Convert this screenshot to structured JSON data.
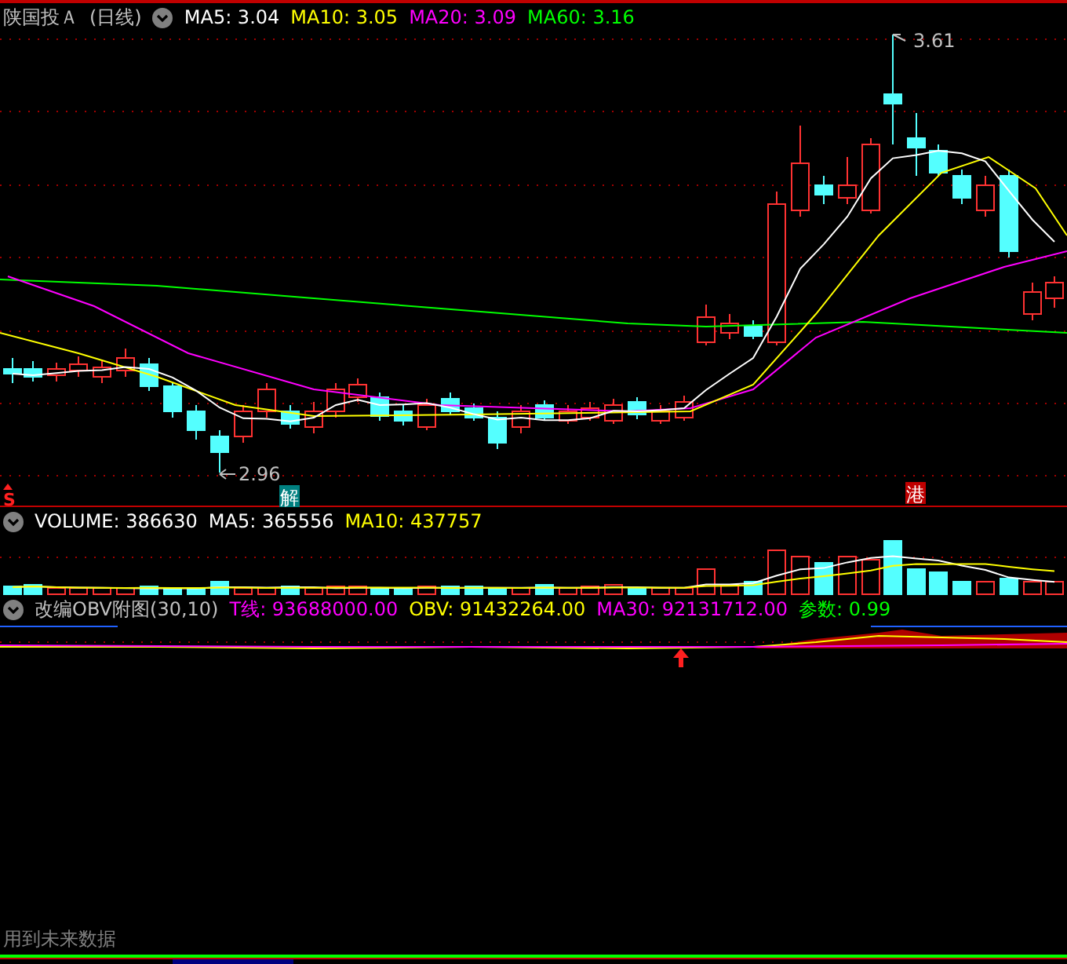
{
  "header": {
    "title": "陕国投Ａ",
    "period": "(日线)",
    "indicators": [
      {
        "label": "MA5: 3.04",
        "color": "#ffffff"
      },
      {
        "label": "MA10: 3.05",
        "color": "#ffff00"
      },
      {
        "label": "MA20: 3.09",
        "color": "#ff00ff"
      },
      {
        "label": "MA60: 3.16",
        "color": "#00ff00"
      }
    ]
  },
  "main_chart": {
    "high_label": "3.61",
    "low_label": "2.96",
    "markers": [
      {
        "kind": "signal",
        "text": "S"
      },
      {
        "kind": "badge",
        "text": "解",
        "color": "#008080"
      },
      {
        "kind": "badge",
        "text": "港",
        "color": "#c00000"
      }
    ]
  },
  "volume_panel": {
    "indicators": [
      {
        "label": "VOLUME: 386630",
        "color": "#ffffff"
      },
      {
        "label": "MA5: 365556",
        "color": "#ffffff"
      },
      {
        "label": "MA10: 437757",
        "color": "#ffff00"
      }
    ]
  },
  "obv_panel": {
    "indicators": [
      {
        "label": "改编OBV附图(30,10)",
        "color": "#c0c0c0"
      },
      {
        "label": "T线: 93688000.00",
        "color": "#ff00ff"
      },
      {
        "label": "OBV: 91432264.00",
        "color": "#ffff00"
      },
      {
        "label": "MA30: 92131712.00",
        "color": "#ff00ff"
      },
      {
        "label": "参数: 0.99",
        "color": "#00ff00"
      }
    ]
  },
  "footer": {
    "text": "用到未来数据"
  }
}
